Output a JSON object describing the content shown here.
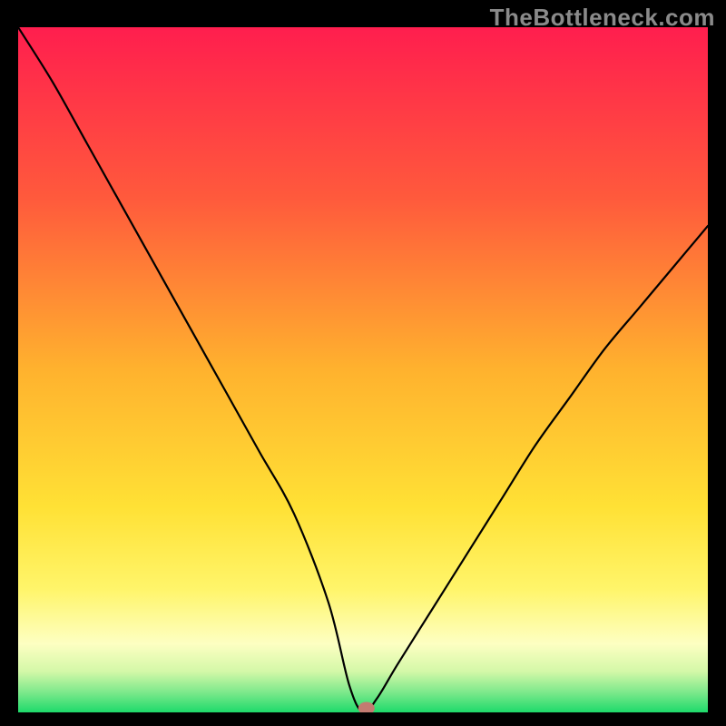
{
  "watermark": "TheBottleneck.com",
  "chart_data": {
    "type": "line",
    "title": "",
    "xlabel": "",
    "ylabel": "",
    "xlim": [
      0,
      100
    ],
    "ylim": [
      0,
      100
    ],
    "gradient_stops": [
      {
        "offset": 0.0,
        "color": "#ff1e4e"
      },
      {
        "offset": 0.25,
        "color": "#ff5a3c"
      },
      {
        "offset": 0.5,
        "color": "#ffb22e"
      },
      {
        "offset": 0.7,
        "color": "#ffe135"
      },
      {
        "offset": 0.82,
        "color": "#fff56a"
      },
      {
        "offset": 0.9,
        "color": "#fdffc2"
      },
      {
        "offset": 0.94,
        "color": "#d4f8a8"
      },
      {
        "offset": 0.97,
        "color": "#7fe98c"
      },
      {
        "offset": 1.0,
        "color": "#1eda6b"
      }
    ],
    "series": [
      {
        "name": "bottleneck-curve",
        "x": [
          0,
          5,
          10,
          15,
          20,
          25,
          30,
          35,
          40,
          45,
          48,
          50,
          52,
          55,
          60,
          65,
          70,
          75,
          80,
          85,
          90,
          95,
          100
        ],
        "y": [
          100,
          92,
          83,
          74,
          65,
          56,
          47,
          38,
          29,
          16,
          4,
          0,
          2,
          7,
          15,
          23,
          31,
          39,
          46,
          53,
          59,
          65,
          71
        ]
      }
    ],
    "marker": {
      "x": 50.5,
      "y": 0.6,
      "color": "#c37b71"
    }
  }
}
